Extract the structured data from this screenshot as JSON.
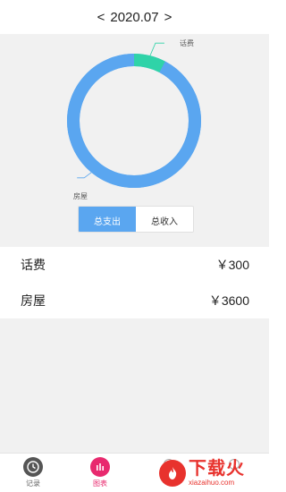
{
  "header": {
    "prev_arrow": "<",
    "month": "2020.07",
    "next_arrow": ">"
  },
  "chart": {
    "slices": [
      {
        "name": "话费",
        "value": 300,
        "color": "#2fd3a8"
      },
      {
        "name": "房屋",
        "value": 3600,
        "color": "#5aa6f0"
      }
    ]
  },
  "toggle": {
    "expense_label": "总支出",
    "income_label": "总收入",
    "active": "expense"
  },
  "list": [
    {
      "name": "话费",
      "amount": "￥300"
    },
    {
      "name": "房屋",
      "amount": "￥3600"
    }
  ],
  "nav": {
    "records_label": "记录",
    "charts_label": "图表",
    "records_icon": "clock-icon",
    "charts_icon": "bar-chart-icon"
  },
  "watermark": {
    "title": "下载火",
    "subtitle": "xiazaihuo.com"
  }
}
